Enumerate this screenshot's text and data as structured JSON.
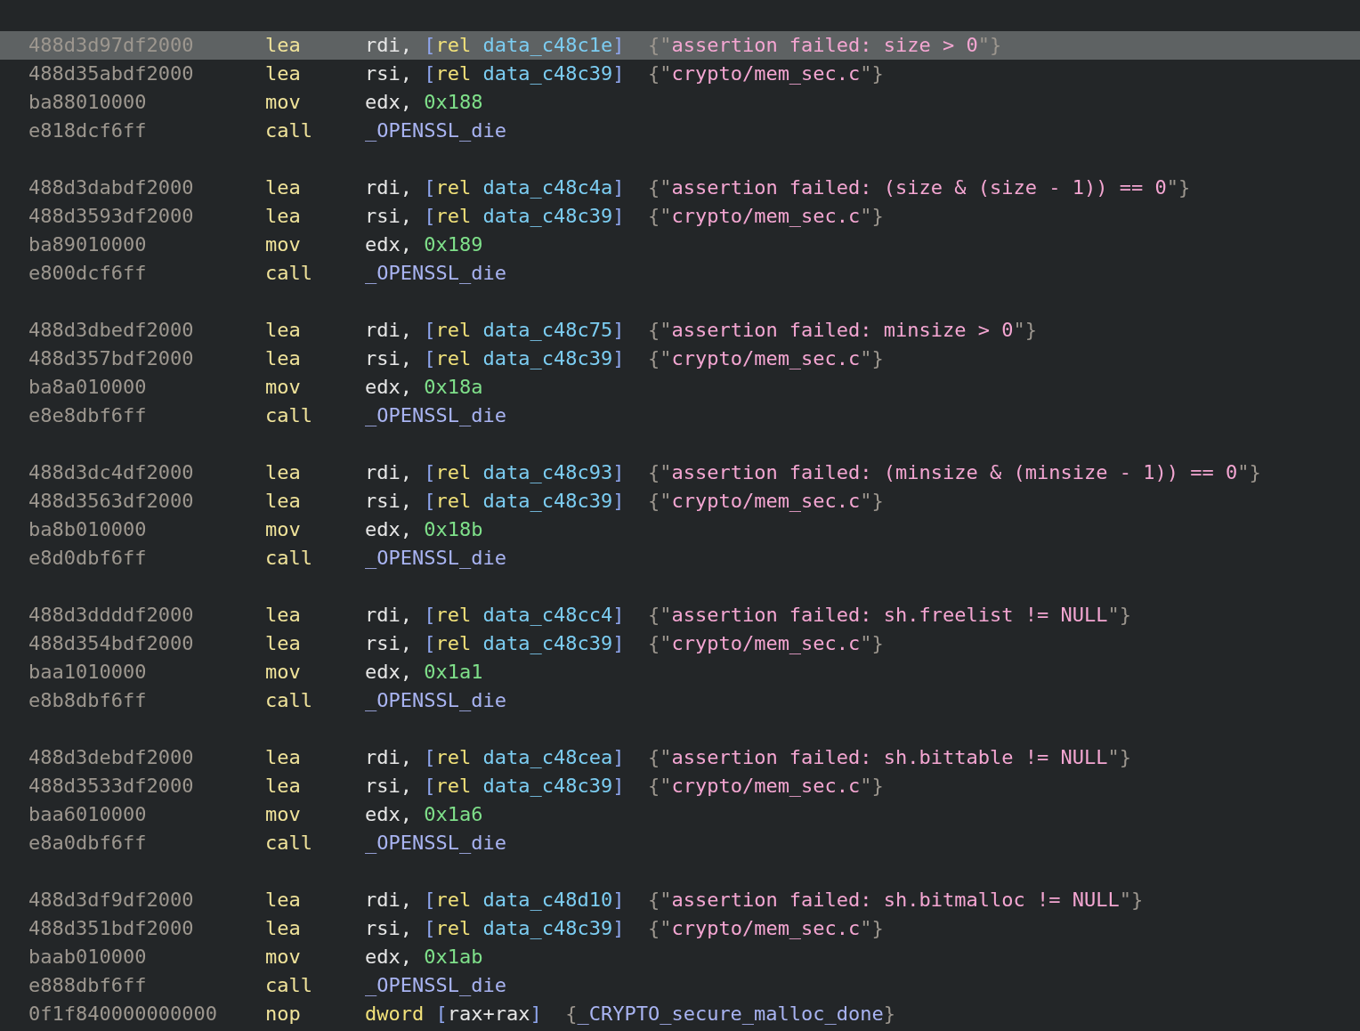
{
  "groups": [
    {
      "instructions": [
        {
          "bytes": "488d3d97df2000",
          "mnemonic": "lea",
          "selected": true,
          "operands": [
            {
              "kind": "reg",
              "text": "rdi, "
            },
            {
              "kind": "bracket",
              "text": "["
            },
            {
              "kind": "keyword",
              "text": "rel"
            },
            {
              "kind": "symbol",
              "text": " data_c48c1e"
            },
            {
              "kind": "bracket",
              "text": "]"
            }
          ],
          "comment": [
            {
              "kind": "brace",
              "text": "{\""
            },
            {
              "kind": "string",
              "text": "assertion failed: size > 0"
            },
            {
              "kind": "brace",
              "text": "\"}"
            }
          ]
        },
        {
          "bytes": "488d35abdf2000",
          "mnemonic": "lea",
          "selected": false,
          "operands": [
            {
              "kind": "reg",
              "text": "rsi, "
            },
            {
              "kind": "bracket",
              "text": "["
            },
            {
              "kind": "keyword",
              "text": "rel"
            },
            {
              "kind": "symbol",
              "text": " data_c48c39"
            },
            {
              "kind": "bracket",
              "text": "]"
            }
          ],
          "comment": [
            {
              "kind": "brace",
              "text": "{\""
            },
            {
              "kind": "string",
              "text": "crypto/mem_sec.c"
            },
            {
              "kind": "brace",
              "text": "\"}"
            }
          ]
        },
        {
          "bytes": "ba88010000",
          "mnemonic": "mov",
          "selected": false,
          "operands": [
            {
              "kind": "reg",
              "text": "edx, "
            },
            {
              "kind": "number",
              "text": "0x188"
            }
          ]
        },
        {
          "bytes": "e818dcf6ff",
          "mnemonic": "call",
          "selected": false,
          "operands": [
            {
              "kind": "func",
              "text": "_OPENSSL_die"
            }
          ]
        }
      ]
    },
    {
      "instructions": [
        {
          "bytes": "488d3dabdf2000",
          "mnemonic": "lea",
          "selected": false,
          "operands": [
            {
              "kind": "reg",
              "text": "rdi, "
            },
            {
              "kind": "bracket",
              "text": "["
            },
            {
              "kind": "keyword",
              "text": "rel"
            },
            {
              "kind": "symbol",
              "text": " data_c48c4a"
            },
            {
              "kind": "bracket",
              "text": "]"
            }
          ],
          "comment": [
            {
              "kind": "brace",
              "text": "{\""
            },
            {
              "kind": "string",
              "text": "assertion failed: (size & (size - 1)) == 0"
            },
            {
              "kind": "brace",
              "text": "\"}"
            }
          ]
        },
        {
          "bytes": "488d3593df2000",
          "mnemonic": "lea",
          "selected": false,
          "operands": [
            {
              "kind": "reg",
              "text": "rsi, "
            },
            {
              "kind": "bracket",
              "text": "["
            },
            {
              "kind": "keyword",
              "text": "rel"
            },
            {
              "kind": "symbol",
              "text": " data_c48c39"
            },
            {
              "kind": "bracket",
              "text": "]"
            }
          ],
          "comment": [
            {
              "kind": "brace",
              "text": "{\""
            },
            {
              "kind": "string",
              "text": "crypto/mem_sec.c"
            },
            {
              "kind": "brace",
              "text": "\"}"
            }
          ]
        },
        {
          "bytes": "ba89010000",
          "mnemonic": "mov",
          "selected": false,
          "operands": [
            {
              "kind": "reg",
              "text": "edx, "
            },
            {
              "kind": "number",
              "text": "0x189"
            }
          ]
        },
        {
          "bytes": "e800dcf6ff",
          "mnemonic": "call",
          "selected": false,
          "operands": [
            {
              "kind": "func",
              "text": "_OPENSSL_die"
            }
          ]
        }
      ]
    },
    {
      "instructions": [
        {
          "bytes": "488d3dbedf2000",
          "mnemonic": "lea",
          "selected": false,
          "operands": [
            {
              "kind": "reg",
              "text": "rdi, "
            },
            {
              "kind": "bracket",
              "text": "["
            },
            {
              "kind": "keyword",
              "text": "rel"
            },
            {
              "kind": "symbol",
              "text": " data_c48c75"
            },
            {
              "kind": "bracket",
              "text": "]"
            }
          ],
          "comment": [
            {
              "kind": "brace",
              "text": "{\""
            },
            {
              "kind": "string",
              "text": "assertion failed: minsize > 0"
            },
            {
              "kind": "brace",
              "text": "\"}"
            }
          ]
        },
        {
          "bytes": "488d357bdf2000",
          "mnemonic": "lea",
          "selected": false,
          "operands": [
            {
              "kind": "reg",
              "text": "rsi, "
            },
            {
              "kind": "bracket",
              "text": "["
            },
            {
              "kind": "keyword",
              "text": "rel"
            },
            {
              "kind": "symbol",
              "text": " data_c48c39"
            },
            {
              "kind": "bracket",
              "text": "]"
            }
          ],
          "comment": [
            {
              "kind": "brace",
              "text": "{\""
            },
            {
              "kind": "string",
              "text": "crypto/mem_sec.c"
            },
            {
              "kind": "brace",
              "text": "\"}"
            }
          ]
        },
        {
          "bytes": "ba8a010000",
          "mnemonic": "mov",
          "selected": false,
          "operands": [
            {
              "kind": "reg",
              "text": "edx, "
            },
            {
              "kind": "number",
              "text": "0x18a"
            }
          ]
        },
        {
          "bytes": "e8e8dbf6ff",
          "mnemonic": "call",
          "selected": false,
          "operands": [
            {
              "kind": "func",
              "text": "_OPENSSL_die"
            }
          ]
        }
      ]
    },
    {
      "instructions": [
        {
          "bytes": "488d3dc4df2000",
          "mnemonic": "lea",
          "selected": false,
          "operands": [
            {
              "kind": "reg",
              "text": "rdi, "
            },
            {
              "kind": "bracket",
              "text": "["
            },
            {
              "kind": "keyword",
              "text": "rel"
            },
            {
              "kind": "symbol",
              "text": " data_c48c93"
            },
            {
              "kind": "bracket",
              "text": "]"
            }
          ],
          "comment": [
            {
              "kind": "brace",
              "text": "{\""
            },
            {
              "kind": "string",
              "text": "assertion failed: (minsize & (minsize - 1)) == 0"
            },
            {
              "kind": "brace",
              "text": "\"}"
            }
          ]
        },
        {
          "bytes": "488d3563df2000",
          "mnemonic": "lea",
          "selected": false,
          "operands": [
            {
              "kind": "reg",
              "text": "rsi, "
            },
            {
              "kind": "bracket",
              "text": "["
            },
            {
              "kind": "keyword",
              "text": "rel"
            },
            {
              "kind": "symbol",
              "text": " data_c48c39"
            },
            {
              "kind": "bracket",
              "text": "]"
            }
          ],
          "comment": [
            {
              "kind": "brace",
              "text": "{\""
            },
            {
              "kind": "string",
              "text": "crypto/mem_sec.c"
            },
            {
              "kind": "brace",
              "text": "\"}"
            }
          ]
        },
        {
          "bytes": "ba8b010000",
          "mnemonic": "mov",
          "selected": false,
          "operands": [
            {
              "kind": "reg",
              "text": "edx, "
            },
            {
              "kind": "number",
              "text": "0x18b"
            }
          ]
        },
        {
          "bytes": "e8d0dbf6ff",
          "mnemonic": "call",
          "selected": false,
          "operands": [
            {
              "kind": "func",
              "text": "_OPENSSL_die"
            }
          ]
        }
      ]
    },
    {
      "instructions": [
        {
          "bytes": "488d3ddddf2000",
          "mnemonic": "lea",
          "selected": false,
          "operands": [
            {
              "kind": "reg",
              "text": "rdi, "
            },
            {
              "kind": "bracket",
              "text": "["
            },
            {
              "kind": "keyword",
              "text": "rel"
            },
            {
              "kind": "symbol",
              "text": " data_c48cc4"
            },
            {
              "kind": "bracket",
              "text": "]"
            }
          ],
          "comment": [
            {
              "kind": "brace",
              "text": "{\""
            },
            {
              "kind": "string",
              "text": "assertion failed: sh.freelist != NULL"
            },
            {
              "kind": "brace",
              "text": "\"}"
            }
          ]
        },
        {
          "bytes": "488d354bdf2000",
          "mnemonic": "lea",
          "selected": false,
          "operands": [
            {
              "kind": "reg",
              "text": "rsi, "
            },
            {
              "kind": "bracket",
              "text": "["
            },
            {
              "kind": "keyword",
              "text": "rel"
            },
            {
              "kind": "symbol",
              "text": " data_c48c39"
            },
            {
              "kind": "bracket",
              "text": "]"
            }
          ],
          "comment": [
            {
              "kind": "brace",
              "text": "{\""
            },
            {
              "kind": "string",
              "text": "crypto/mem_sec.c"
            },
            {
              "kind": "brace",
              "text": "\"}"
            }
          ]
        },
        {
          "bytes": "baa1010000",
          "mnemonic": "mov",
          "selected": false,
          "operands": [
            {
              "kind": "reg",
              "text": "edx, "
            },
            {
              "kind": "number",
              "text": "0x1a1"
            }
          ]
        },
        {
          "bytes": "e8b8dbf6ff",
          "mnemonic": "call",
          "selected": false,
          "operands": [
            {
              "kind": "func",
              "text": "_OPENSSL_die"
            }
          ]
        }
      ]
    },
    {
      "instructions": [
        {
          "bytes": "488d3debdf2000",
          "mnemonic": "lea",
          "selected": false,
          "operands": [
            {
              "kind": "reg",
              "text": "rdi, "
            },
            {
              "kind": "bracket",
              "text": "["
            },
            {
              "kind": "keyword",
              "text": "rel"
            },
            {
              "kind": "symbol",
              "text": " data_c48cea"
            },
            {
              "kind": "bracket",
              "text": "]"
            }
          ],
          "comment": [
            {
              "kind": "brace",
              "text": "{\""
            },
            {
              "kind": "string",
              "text": "assertion failed: sh.bittable != NULL"
            },
            {
              "kind": "brace",
              "text": "\"}"
            }
          ]
        },
        {
          "bytes": "488d3533df2000",
          "mnemonic": "lea",
          "selected": false,
          "operands": [
            {
              "kind": "reg",
              "text": "rsi, "
            },
            {
              "kind": "bracket",
              "text": "["
            },
            {
              "kind": "keyword",
              "text": "rel"
            },
            {
              "kind": "symbol",
              "text": " data_c48c39"
            },
            {
              "kind": "bracket",
              "text": "]"
            }
          ],
          "comment": [
            {
              "kind": "brace",
              "text": "{\""
            },
            {
              "kind": "string",
              "text": "crypto/mem_sec.c"
            },
            {
              "kind": "brace",
              "text": "\"}"
            }
          ]
        },
        {
          "bytes": "baa6010000",
          "mnemonic": "mov",
          "selected": false,
          "operands": [
            {
              "kind": "reg",
              "text": "edx, "
            },
            {
              "kind": "number",
              "text": "0x1a6"
            }
          ]
        },
        {
          "bytes": "e8a0dbf6ff",
          "mnemonic": "call",
          "selected": false,
          "operands": [
            {
              "kind": "func",
              "text": "_OPENSSL_die"
            }
          ]
        }
      ]
    },
    {
      "instructions": [
        {
          "bytes": "488d3df9df2000",
          "mnemonic": "lea",
          "selected": false,
          "operands": [
            {
              "kind": "reg",
              "text": "rdi, "
            },
            {
              "kind": "bracket",
              "text": "["
            },
            {
              "kind": "keyword",
              "text": "rel"
            },
            {
              "kind": "symbol",
              "text": " data_c48d10"
            },
            {
              "kind": "bracket",
              "text": "]"
            }
          ],
          "comment": [
            {
              "kind": "brace",
              "text": "{\""
            },
            {
              "kind": "string",
              "text": "assertion failed: sh.bitmalloc != NULL"
            },
            {
              "kind": "brace",
              "text": "\"}"
            }
          ]
        },
        {
          "bytes": "488d351bdf2000",
          "mnemonic": "lea",
          "selected": false,
          "operands": [
            {
              "kind": "reg",
              "text": "rsi, "
            },
            {
              "kind": "bracket",
              "text": "["
            },
            {
              "kind": "keyword",
              "text": "rel"
            },
            {
              "kind": "symbol",
              "text": " data_c48c39"
            },
            {
              "kind": "bracket",
              "text": "]"
            }
          ],
          "comment": [
            {
              "kind": "brace",
              "text": "{\""
            },
            {
              "kind": "string",
              "text": "crypto/mem_sec.c"
            },
            {
              "kind": "brace",
              "text": "\"}"
            }
          ]
        },
        {
          "bytes": "baab010000",
          "mnemonic": "mov",
          "selected": false,
          "operands": [
            {
              "kind": "reg",
              "text": "edx, "
            },
            {
              "kind": "number",
              "text": "0x1ab"
            }
          ]
        },
        {
          "bytes": "e888dbf6ff",
          "mnemonic": "call",
          "selected": false,
          "operands": [
            {
              "kind": "func",
              "text": "_OPENSSL_die"
            }
          ]
        },
        {
          "bytes": "0f1f840000000000",
          "mnemonic": "nop",
          "selected": false,
          "operands": [
            {
              "kind": "keyword",
              "text": "dword"
            },
            {
              "kind": "bracket",
              "text": " ["
            },
            {
              "kind": "reg",
              "text": "rax+rax"
            },
            {
              "kind": "bracket",
              "text": "]"
            }
          ],
          "comment": [
            {
              "kind": "brace",
              "text": "{"
            },
            {
              "kind": "func",
              "text": "_CRYPTO_secure_malloc_done"
            },
            {
              "kind": "brace",
              "text": "}"
            }
          ]
        }
      ]
    }
  ]
}
